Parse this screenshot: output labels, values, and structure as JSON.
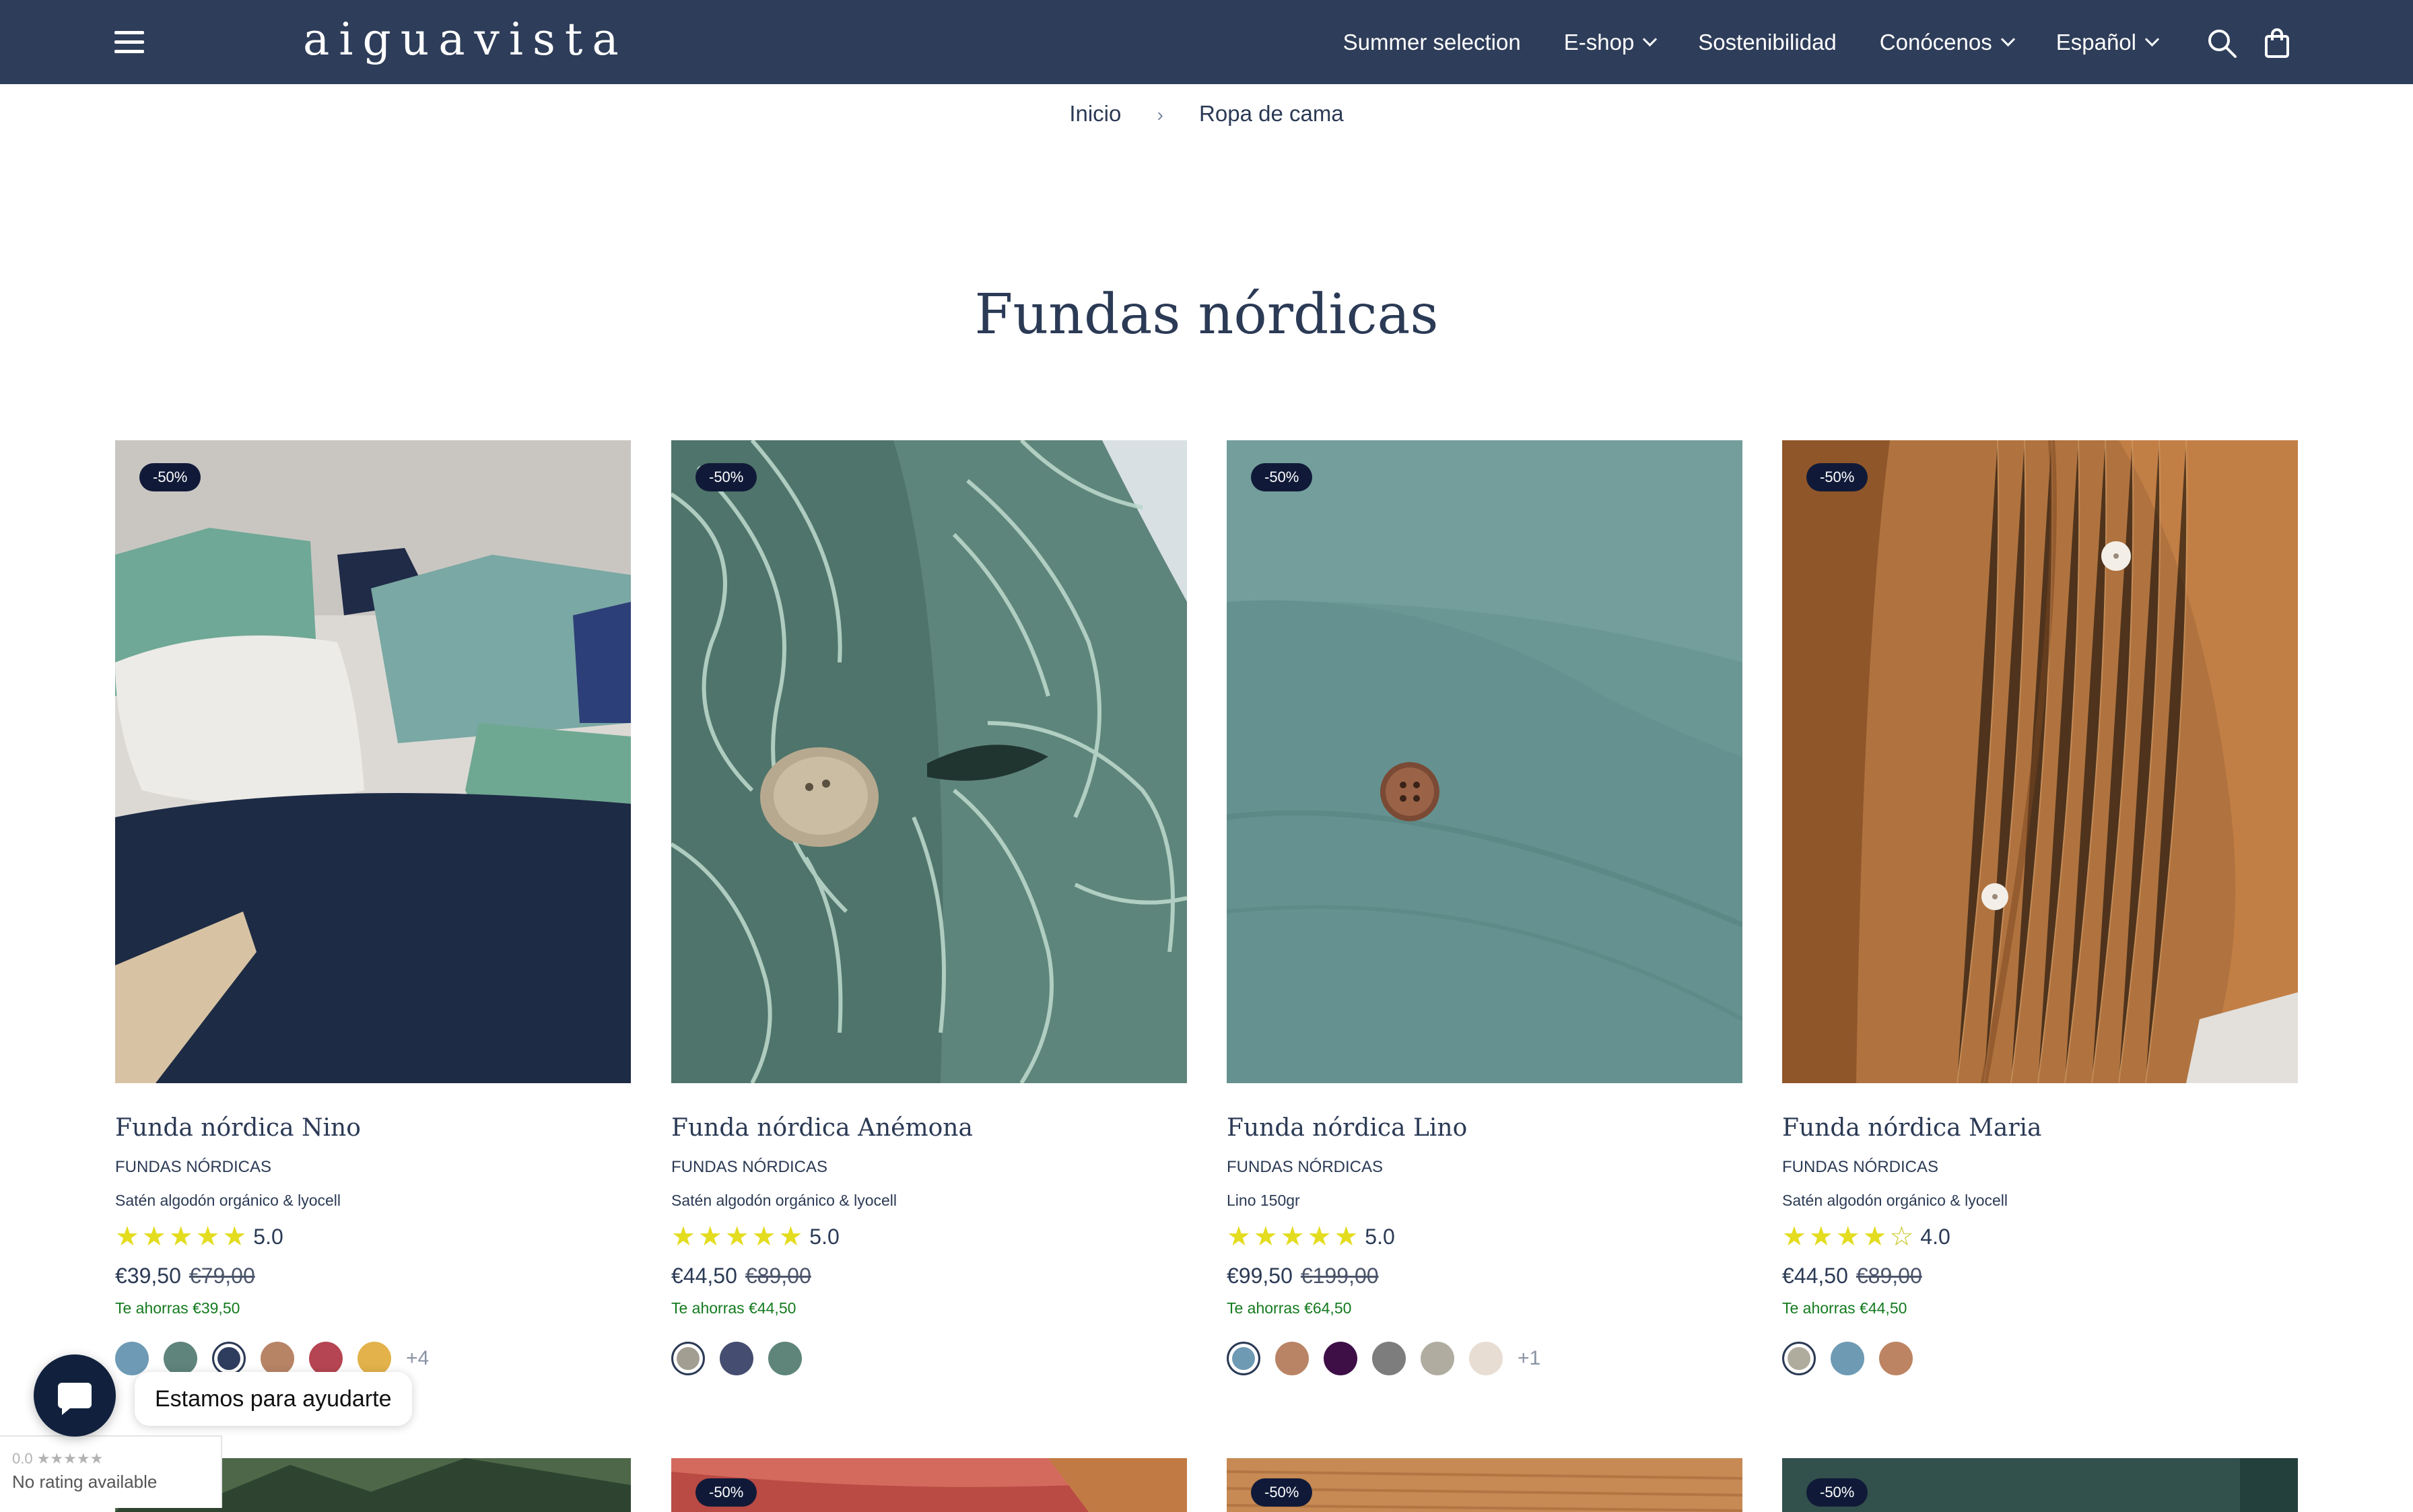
{
  "header": {
    "logo": "aiguavista",
    "nav": [
      {
        "label": "Summer selection",
        "dropdown": false
      },
      {
        "label": "E-shop",
        "dropdown": true
      },
      {
        "label": "Sostenibilidad",
        "dropdown": false
      },
      {
        "label": "Conócenos",
        "dropdown": true
      },
      {
        "label": "Español",
        "dropdown": true
      }
    ]
  },
  "breadcrumb": {
    "home": "Inicio",
    "current": "Ropa de cama"
  },
  "page_title": "Fundas nórdicas",
  "products": [
    {
      "badge": "-50%",
      "name": "Funda nórdica Nino",
      "category": "FUNDAS NÓRDICAS",
      "material": "Satén algodón orgánico & lyocell",
      "rating": "5.0",
      "stars": 5,
      "price": "€39,50",
      "old_price": "€79,00",
      "savings": "Te ahorras €39,50",
      "swatches": [
        "#6e9ab5",
        "#5f847b",
        "#2e3d5e",
        "#b88466",
        "#b54552",
        "#e3b24a"
      ],
      "selected_swatch": 2,
      "more": "+4"
    },
    {
      "badge": "-50%",
      "name": "Funda nórdica Anémona",
      "category": "FUNDAS NÓRDICAS",
      "material": "Satén algodón orgánico & lyocell",
      "rating": "5.0",
      "stars": 5,
      "price": "€44,50",
      "old_price": "€89,00",
      "savings": "Te ahorras €44,50",
      "swatches": [
        "#a29f92",
        "#454d70",
        "#5f857a"
      ],
      "selected_swatch": 0,
      "more": ""
    },
    {
      "badge": "-50%",
      "name": "Funda nórdica Lino",
      "category": "FUNDAS NÓRDICAS",
      "material": "Lino 150gr",
      "rating": "5.0",
      "stars": 5,
      "price": "€99,50",
      "old_price": "€199,00",
      "savings": "Te ahorras €64,50",
      "swatches": [
        "#6f9ab3",
        "#b98466",
        "#3e0f47",
        "#7d7d7d",
        "#b0aca0",
        "#e8ddd3"
      ],
      "selected_swatch": 0,
      "more": "+1"
    },
    {
      "badge": "-50%",
      "name": "Funda nórdica Maria",
      "category": "FUNDAS NÓRDICAS",
      "material": "Satén algodón orgánico & lyocell",
      "rating": "4.0",
      "stars": 4,
      "price": "€44,50",
      "old_price": "€89,00",
      "savings": "Te ahorras €44,50",
      "swatches": [
        "#b0ac9d",
        "#6e9ab4",
        "#bd8463"
      ],
      "selected_swatch": 0,
      "more": ""
    }
  ],
  "second_row_badges": [
    "-50%",
    "-50%",
    "-50%"
  ],
  "chat": {
    "label": "Estamos para ayudarte"
  },
  "rating_widget": {
    "score": "0.0",
    "text": "No rating available"
  }
}
